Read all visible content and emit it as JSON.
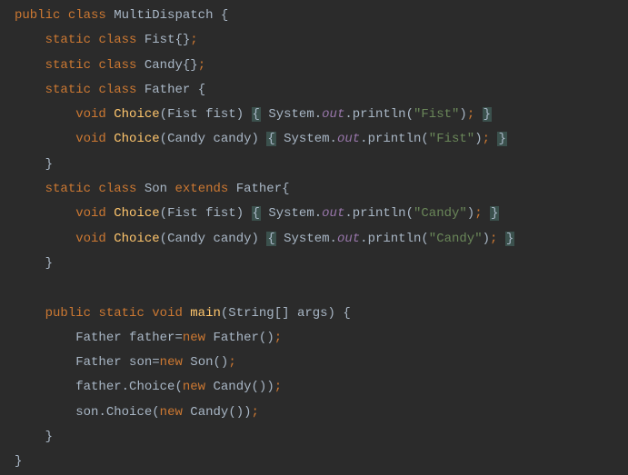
{
  "tokens": {
    "kw_public": "public",
    "kw_class": "class",
    "kw_static": "static",
    "kw_void": "void",
    "kw_extends": "extends",
    "kw_new": "new",
    "class_MultiDispatch": "MultiDispatch",
    "class_Fist": "Fist",
    "class_Candy": "Candy",
    "class_Father": "Father",
    "class_Son": "Son",
    "var_fist": "fist",
    "var_candy": "candy",
    "var_father": "father",
    "var_son": "son",
    "var_args": "args",
    "method_Choice": "Choice",
    "method_main": "main",
    "method_println": "println",
    "class_System": "System",
    "field_out": "out",
    "class_String": "String",
    "str_Fist": "\"Fist\"",
    "str_Candy": "\"Candy\"",
    "brace_open": "{",
    "brace_close": "}",
    "paren_empty": "()",
    "semi": ";",
    "dot": ".",
    "eq": "=",
    "brackets": "[]"
  }
}
